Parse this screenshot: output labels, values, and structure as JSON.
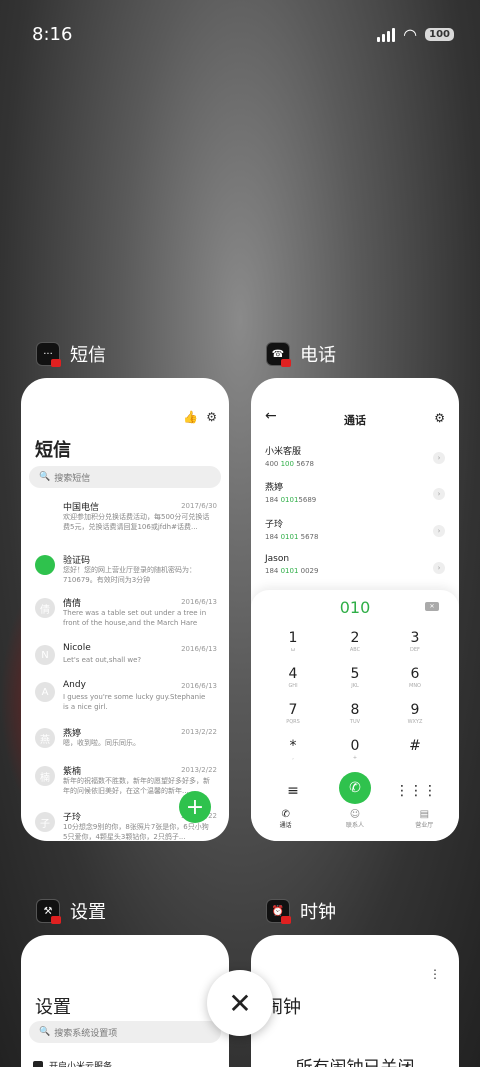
{
  "status": {
    "time": "8:16",
    "battery": "100"
  },
  "apps": {
    "sms": {
      "label": "短信",
      "title": "短信",
      "search_placeholder": "搜索短信",
      "messages": [
        {
          "initial": "",
          "name": "中国电信",
          "date": "2017/6/30",
          "body": "欢迎参加积分兑换话费活动，每500分可兑换话费5元，兑换话费请回复106或jfdh#话费..."
        },
        {
          "initial": "",
          "name": "验证码",
          "date": "",
          "body": "您好！您的网上营业厅登录的随机密码为：710679。有效时间为3分钟"
        },
        {
          "initial": "倩",
          "name": "倩倩",
          "date": "2016/6/13",
          "body": "There was a table set out under a tree in front of the house,and the March Hare an..."
        },
        {
          "initial": "N",
          "name": "Nicole",
          "date": "2016/6/13",
          "body": "Let's eat out,shall we?"
        },
        {
          "initial": "A",
          "name": "Andy",
          "date": "2016/6/13",
          "body": "I guess you're some lucky guy.Stephanie is a nice girl."
        },
        {
          "initial": "燕",
          "name": "燕婷",
          "date": "2013/2/22",
          "body": "嗯，收到啦。同乐同乐。"
        },
        {
          "initial": "楠",
          "name": "紫楠",
          "date": "2013/2/22",
          "body": "新年的祝福数不胜数，新年的愿望好多好多，新年的问候依旧美好，在这个温馨的新年..."
        },
        {
          "initial": "子",
          "name": "子玲",
          "date": "2013/2/22",
          "body": "10分想念9别的你，8张照片7张是你，6只小狗5只爱你，4颗星头3颗钻你，2只鸽子..."
        }
      ]
    },
    "phone": {
      "label": "电话",
      "title": "通话",
      "contacts": [
        {
          "name": "小米客服",
          "num_pre": "400 ",
          "num_hl": "100",
          "num_post": " 5678"
        },
        {
          "name": "燕婷",
          "num_pre": "184 ",
          "num_hl": "0101",
          "num_post": "5689"
        },
        {
          "name": "子玲",
          "num_pre": "184 ",
          "num_hl": "0101",
          "num_post": " 5678"
        },
        {
          "name": "Jason",
          "num_pre": "184 ",
          "num_hl": "0101",
          "num_post": " 0029"
        }
      ],
      "dial_input": "010",
      "keys": [
        {
          "d": "1",
          "l": "ω"
        },
        {
          "d": "2",
          "l": "ABC"
        },
        {
          "d": "3",
          "l": "DEF"
        },
        {
          "d": "4",
          "l": "GHI"
        },
        {
          "d": "5",
          "l": "JKL"
        },
        {
          "d": "6",
          "l": "MNO"
        },
        {
          "d": "7",
          "l": "PQRS"
        },
        {
          "d": "8",
          "l": "TUV"
        },
        {
          "d": "9",
          "l": "WXYZ"
        },
        {
          "d": "*",
          "l": ","
        },
        {
          "d": "0",
          "l": "+"
        },
        {
          "d": "#",
          "l": ""
        }
      ],
      "tabs": {
        "calls": "通话",
        "contacts": "联系人",
        "hall": "营业厅"
      }
    },
    "settings": {
      "label": "设置",
      "title": "设置",
      "search_placeholder": "搜索系统设置项",
      "first_item": "开启小米云服务"
    },
    "clock": {
      "label": "时钟",
      "title": "闹钟",
      "empty_text": "所有闹钟已关闭"
    }
  },
  "colors": {
    "accent_green": "#2fc24d"
  }
}
